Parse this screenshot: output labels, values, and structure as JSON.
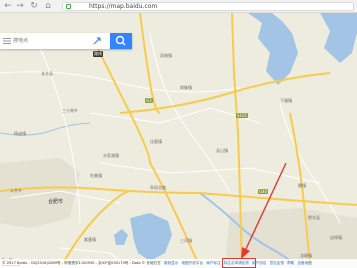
{
  "browser": {
    "url": "https://map.baidu.com",
    "back_glyph": "←",
    "forward_glyph": "→",
    "refresh_glyph": "↻",
    "home_glyph": "⌂"
  },
  "search": {
    "placeholder": "搜地点",
    "route_label": "路线"
  },
  "map_labels": {
    "places": [
      {
        "name": "长丰县",
        "major": false
      },
      {
        "name": "双墩镇",
        "major": false
      },
      {
        "name": "岗集镇",
        "major": false
      },
      {
        "name": "三十岗乡",
        "major": false
      },
      {
        "name": "杨庙镇",
        "major": false
      },
      {
        "name": "庄墓镇",
        "major": false
      },
      {
        "name": "吴山镇",
        "major": false
      },
      {
        "name": "下塘镇",
        "major": false
      },
      {
        "name": "水家湖镇",
        "major": false
      },
      {
        "name": "义井乡",
        "major": false
      },
      {
        "name": "杜集镇",
        "major": false
      },
      {
        "name": "撮镇",
        "major": false
      },
      {
        "name": "阜阳北路",
        "major": false
      },
      {
        "name": "紫蓬镇",
        "major": false
      },
      {
        "name": "三河镇",
        "major": false
      },
      {
        "name": "肥东县",
        "major": false
      },
      {
        "name": "店埠镇",
        "major": false
      },
      {
        "name": "龙塘镇",
        "major": false
      },
      {
        "name": "合肥市",
        "major": true
      }
    ],
    "route_shields": [
      "G3",
      "S101",
      "G40"
    ]
  },
  "scale": {
    "label": "5公里"
  },
  "footer": {
    "copyright": "© 2017 Baidu - GS(2016)2089号 - 甲测资字1100930 - 京ICP证030173号 - Data © 长地万方",
    "links": [
      "新浪显示",
      "地图开放平台",
      "商户标注",
      "标注点申请反馈",
      "用户协议",
      "意见反馈",
      "帮助",
      "百度地图"
    ]
  },
  "colors": {
    "land": "#eeecdf",
    "water": "#a3c4e5",
    "road_major": "#f7cb4d",
    "road_minor": "#ffffff",
    "search_button": "#3385ff",
    "annotation": "#e53935"
  }
}
